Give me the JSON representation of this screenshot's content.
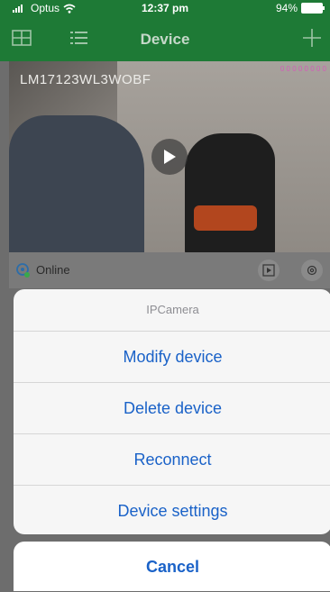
{
  "status_bar": {
    "carrier": "Optus",
    "time": "12:37 pm",
    "battery": "94%"
  },
  "nav": {
    "title": "Device",
    "left_icons": [
      "grid-view-icon",
      "list-view-icon"
    ],
    "right_icon": "add-icon"
  },
  "video": {
    "device_id": "LM17123WL3WOBF",
    "rec_tag": "0 0 0 0 0 0 0 0",
    "play_icon": "play-icon"
  },
  "device_row": {
    "status": "Online",
    "status_icon": "online-camera-icon",
    "playback_icon": "playback-icon",
    "settings_icon": "settings-gear-icon"
  },
  "action_sheet": {
    "title": "IPCamera",
    "items": [
      {
        "label": "Modify device"
      },
      {
        "label": "Delete device"
      },
      {
        "label": "Reconnect"
      },
      {
        "label": "Device settings"
      }
    ],
    "cancel_label": "Cancel"
  },
  "colors": {
    "nav_green": "#1e7a36",
    "action_blue": "#1a62c8"
  }
}
